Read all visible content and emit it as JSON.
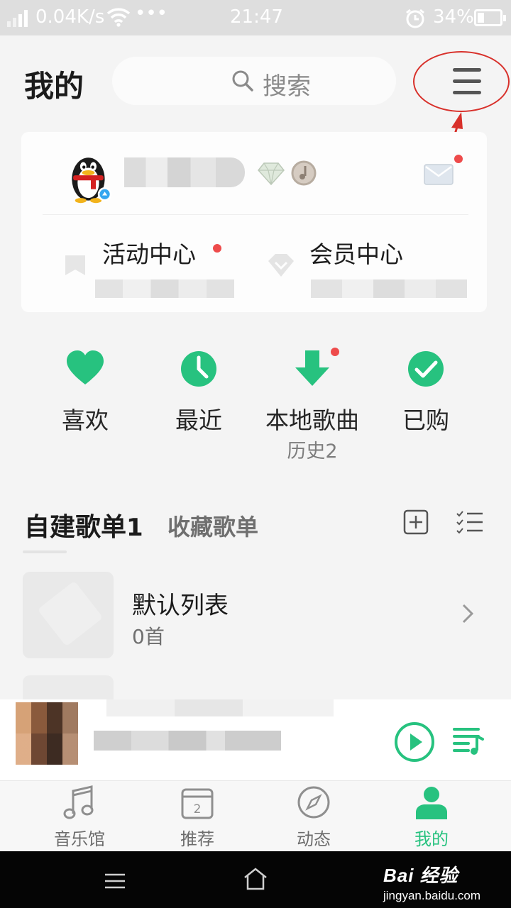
{
  "status_bar": {
    "speed": "0.04K/s",
    "dots": "•••",
    "time": "21:47",
    "battery": "34%",
    "battery_level": 0.34
  },
  "header": {
    "title": "我的",
    "search_placeholder": "搜索"
  },
  "profile_card": {
    "activity_label": "活动中心",
    "vip_label": "会员中心"
  },
  "quick_actions": [
    {
      "label": "喜欢",
      "icon": "heart-icon"
    },
    {
      "label": "最近",
      "icon": "clock-icon"
    },
    {
      "label": "本地歌曲",
      "icon": "download-icon",
      "sub": "历史2"
    },
    {
      "label": "已购",
      "icon": "check-icon"
    }
  ],
  "playlists": {
    "tab_created": "自建歌单",
    "tab_created_count": "1",
    "tab_favorites": "收藏歌单",
    "items": [
      {
        "title": "默认列表",
        "count": "0首"
      }
    ]
  },
  "bottom_nav": [
    {
      "label": "音乐馆",
      "icon": "music-note-icon",
      "active": false
    },
    {
      "label": "推荐",
      "icon": "calendar-icon",
      "active": false,
      "badge": "2"
    },
    {
      "label": "动态",
      "icon": "compass-icon",
      "active": false
    },
    {
      "label": "我的",
      "icon": "person-icon",
      "active": true
    }
  ],
  "watermark": {
    "main": "Bai 经验",
    "sub": "jingyan.baidu.com"
  },
  "colors": {
    "accent_green": "#27c27f",
    "notify_red": "#ee4b4b",
    "annotation_red": "#d8302a"
  }
}
